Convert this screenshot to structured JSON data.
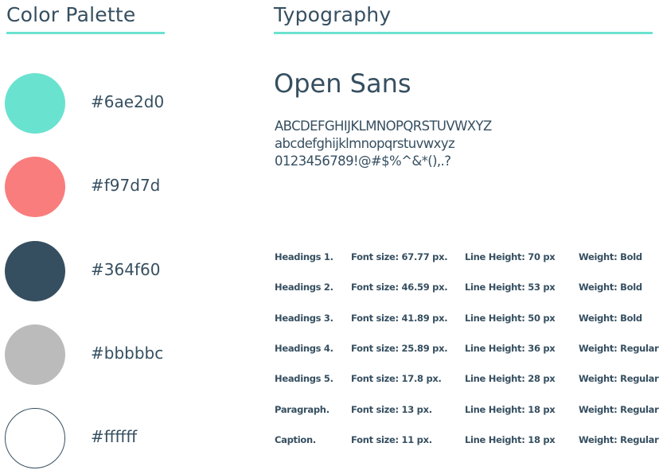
{
  "palette": {
    "title": "Color Palette",
    "colors": [
      {
        "hex": "#6ae2d0",
        "label": "#6ae2d0"
      },
      {
        "hex": "#f97d7d",
        "label": "#f97d7d"
      },
      {
        "hex": "#364f60",
        "label": "#364f60"
      },
      {
        "hex": "#bbbbbc",
        "label": "#bbbbbc"
      },
      {
        "hex": "#ffffff",
        "label": "#ffffff"
      }
    ]
  },
  "typography": {
    "title": "Typography",
    "font_name": "Open Sans",
    "samples": {
      "upper": "ABCDEFGHIJKLMNOPQRSTUVWXYZ",
      "lower": "abcdefghijklmnopqrstuvwxyz",
      "symbols": "0123456789!@#$%^&*(),.?"
    },
    "specs": [
      {
        "name": "Headings 1.",
        "size": "Font size: 67.77 px.",
        "line": "Line Height: 70 px",
        "weight": "Weight: Bold"
      },
      {
        "name": "Headings 2.",
        "size": "Font size: 46.59 px.",
        "line": "Line Height: 53 px",
        "weight": "Weight: Bold"
      },
      {
        "name": "Headings 3.",
        "size": "Font size: 41.89 px.",
        "line": "Line Height: 50 px",
        "weight": "Weight: Bold"
      },
      {
        "name": "Headings 4.",
        "size": "Font size: 25.89 px.",
        "line": "Line Height: 36 px",
        "weight": "Weight: Regular"
      },
      {
        "name": "Headings 5.",
        "size": "Font size: 17.8 px.",
        "line": "Line Height: 28 px",
        "weight": "Weight: Regular"
      },
      {
        "name": "Paragraph.",
        "size": "Font size: 13 px.",
        "line": "Line Height: 18 px",
        "weight": "Weight: Regular"
      },
      {
        "name": "Caption.",
        "size": "Font size: 11 px.",
        "line": "Line Height: 18 px",
        "weight": "Weight: Regular"
      }
    ]
  },
  "colors": {
    "accent": "#6ae2d0",
    "text": "#364f60",
    "swatch_border": "#364f60"
  }
}
